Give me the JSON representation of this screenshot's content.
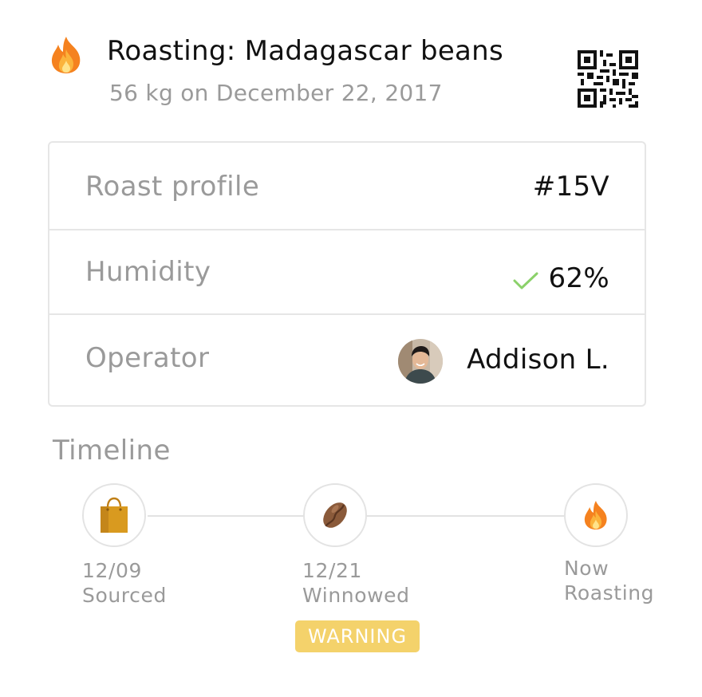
{
  "header": {
    "title": "Roasting: Madagascar beans",
    "subtitle": "56 kg on December 22, 2017",
    "icon": "fire-icon"
  },
  "details": {
    "rows": [
      {
        "label": "Roast profile",
        "value": "#15V"
      },
      {
        "label": "Humidity",
        "value": "62%",
        "status": "ok",
        "status_color": "#8bd16a"
      },
      {
        "label": "Operator",
        "value": "Addison L."
      }
    ]
  },
  "timeline": {
    "title": "Timeline",
    "steps": [
      {
        "date": "12/09",
        "label": "Sourced",
        "icon": "shopping-bag-icon"
      },
      {
        "date": "12/21",
        "label": "Winnowed",
        "icon": "cocoa-bean-icon",
        "badge": "WARNING"
      },
      {
        "date": "Now",
        "label": "Roasting",
        "icon": "fire-icon"
      }
    ]
  },
  "colors": {
    "warning_badge": "#f4d26b",
    "muted_text": "#9a9a9a",
    "border": "#e6e6e6",
    "bag": "#d99a1f",
    "bean": "#8a5a3a"
  }
}
